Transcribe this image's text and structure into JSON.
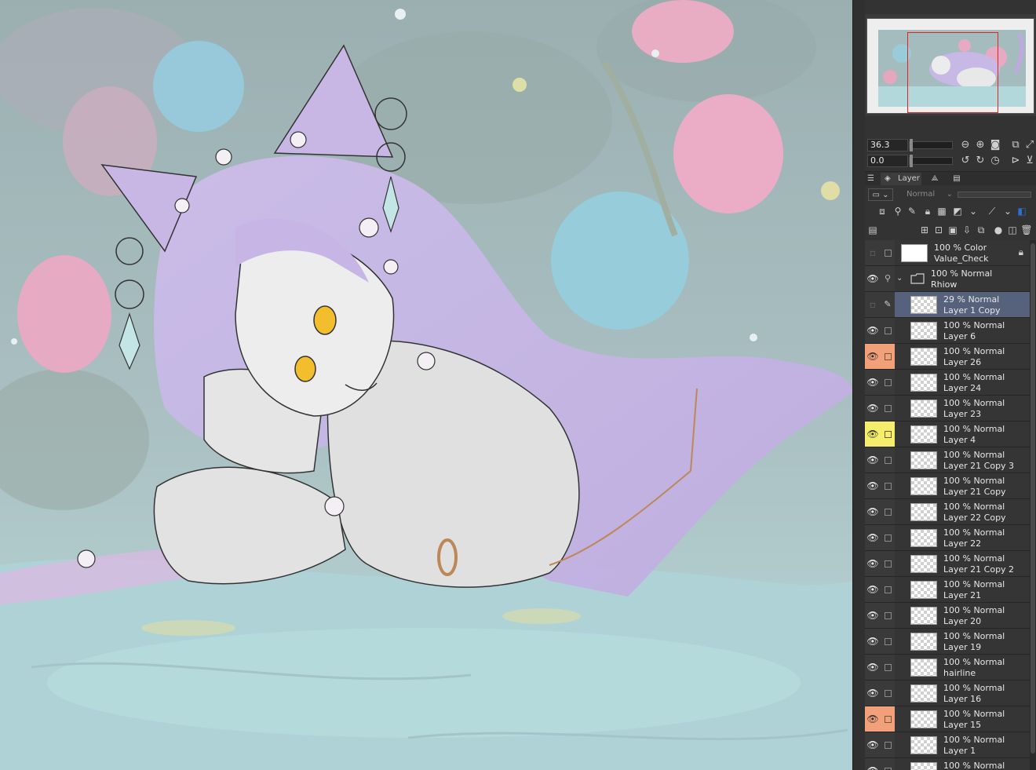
{
  "navigator": {
    "zoom_value": "36.3",
    "rotation_value": "0.0"
  },
  "icons": {
    "zoom_out": "zoom-out-icon",
    "zoom_in": "zoom-in-icon",
    "zoom_fit": "zoom-fit-icon",
    "rotate_left": "rotate-left-icon",
    "rotate_right": "rotate-right-icon",
    "reset_rotation": "reset-rotation-icon",
    "flip": "flip-horizontal-icon"
  },
  "layer_panel": {
    "tab_label": "Layer",
    "blend_mode": "Normal"
  },
  "layers": [
    {
      "mode": "100 % Color",
      "name": "Value_Check",
      "visible": false,
      "highlight": "none",
      "thumb": "solid",
      "locked": true
    },
    {
      "mode": "100 % Normal",
      "name": "Rhiow",
      "visible": true,
      "highlight": "none",
      "thumb": "folder",
      "folder": true
    },
    {
      "mode": "29 % Normal",
      "name": "Layer 1 Copy",
      "visible": false,
      "highlight": "none",
      "thumb": "checker",
      "selected": true,
      "editing": true
    },
    {
      "mode": "100 % Normal",
      "name": "Layer 6",
      "visible": true,
      "highlight": "none",
      "thumb": "checker"
    },
    {
      "mode": "100 % Normal",
      "name": "Layer 26",
      "visible": true,
      "highlight": "orange",
      "thumb": "checker"
    },
    {
      "mode": "100 % Normal",
      "name": "Layer 24",
      "visible": true,
      "highlight": "none",
      "thumb": "checker"
    },
    {
      "mode": "100 % Normal",
      "name": "Layer 23",
      "visible": true,
      "highlight": "none",
      "thumb": "checker"
    },
    {
      "mode": "100 % Normal",
      "name": "Layer 4",
      "visible": true,
      "highlight": "yellow",
      "thumb": "checker"
    },
    {
      "mode": "100 % Normal",
      "name": "Layer 21 Copy 3",
      "visible": true,
      "highlight": "none",
      "thumb": "checker"
    },
    {
      "mode": "100 % Normal",
      "name": "Layer 21 Copy",
      "visible": true,
      "highlight": "none",
      "thumb": "checker"
    },
    {
      "mode": "100 % Normal",
      "name": "Layer 22 Copy",
      "visible": true,
      "highlight": "none",
      "thumb": "checker"
    },
    {
      "mode": "100 % Normal",
      "name": "Layer 22",
      "visible": true,
      "highlight": "none",
      "thumb": "checker"
    },
    {
      "mode": "100 % Normal",
      "name": "Layer 21 Copy 2",
      "visible": true,
      "highlight": "none",
      "thumb": "checker"
    },
    {
      "mode": "100 % Normal",
      "name": "Layer 21",
      "visible": true,
      "highlight": "none",
      "thumb": "checker"
    },
    {
      "mode": "100 % Normal",
      "name": "Layer 20",
      "visible": true,
      "highlight": "none",
      "thumb": "checker"
    },
    {
      "mode": "100 % Normal",
      "name": "Layer 19",
      "visible": true,
      "highlight": "none",
      "thumb": "checker"
    },
    {
      "mode": "100 % Normal",
      "name": "hairline",
      "visible": true,
      "highlight": "none",
      "thumb": "checker"
    },
    {
      "mode": "100 % Normal",
      "name": "Layer 16",
      "visible": true,
      "highlight": "none",
      "thumb": "checker"
    },
    {
      "mode": "100 % Normal",
      "name": "Layer 15",
      "visible": true,
      "highlight": "orange",
      "thumb": "checker"
    },
    {
      "mode": "100 % Normal",
      "name": "Layer 1",
      "visible": true,
      "highlight": "none",
      "thumb": "checker"
    },
    {
      "mode": "100 % Normal",
      "name": "",
      "visible": true,
      "highlight": "none",
      "thumb": "checker"
    }
  ]
}
